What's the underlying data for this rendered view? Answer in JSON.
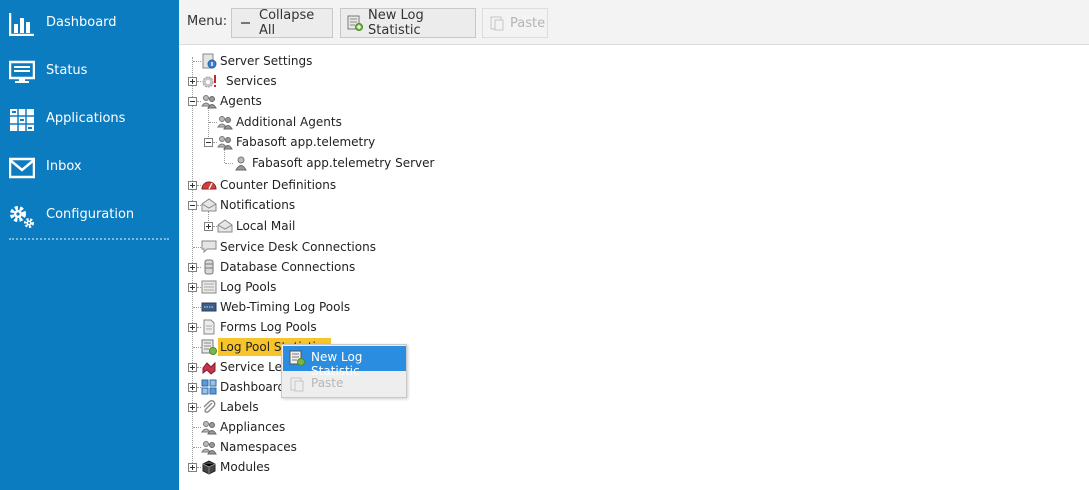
{
  "sidebar": {
    "items": [
      {
        "label": "Dashboard",
        "icon": "bar-chart-icon"
      },
      {
        "label": "Status",
        "icon": "monitor-icon"
      },
      {
        "label": "Applications",
        "icon": "grid-icon"
      },
      {
        "label": "Inbox",
        "icon": "envelope-icon"
      },
      {
        "label": "Configuration",
        "icon": "gears-icon"
      }
    ],
    "color": "#0c7cc0"
  },
  "toolbar": {
    "menu_label": "Menu:",
    "collapse_all_label": "Collapse All",
    "new_log_statistic_label": "New Log Statistic",
    "paste_label": "Paste"
  },
  "tree": {
    "nodes": [
      {
        "label": "Server Settings",
        "icon": "server-settings-icon"
      },
      {
        "label": "Services",
        "icon": "gear-warning-icon"
      },
      {
        "label": "Agents",
        "icon": "agents-icon"
      },
      {
        "label": "Additional Agents",
        "icon": "agents-icon"
      },
      {
        "label": "Fabasoft app.telemetry",
        "icon": "agents-icon"
      },
      {
        "label": "Fabasoft app.telemetry Server",
        "icon": "agent-icon"
      },
      {
        "label": "Counter Definitions",
        "icon": "gauge-icon"
      },
      {
        "label": "Notifications",
        "icon": "envelope-icon"
      },
      {
        "label": "Local Mail",
        "icon": "envelope-icon"
      },
      {
        "label": "Service Desk Connections",
        "icon": "speech-bubble-icon"
      },
      {
        "label": "Database Connections",
        "icon": "database-icon"
      },
      {
        "label": "Log Pools",
        "icon": "log-pool-icon"
      },
      {
        "label": "Web-Timing Log Pools",
        "icon": "web-timing-icon"
      },
      {
        "label": "Forms Log Pools",
        "icon": "form-icon"
      },
      {
        "label": "Log Pool Statistics",
        "icon": "log-statistic-icon"
      },
      {
        "label": "Service Levels",
        "icon": "service-level-icon"
      },
      {
        "label": "Dashboards",
        "icon": "dashboard-icon"
      },
      {
        "label": "Labels",
        "icon": "paperclip-icon"
      },
      {
        "label": "Appliances",
        "icon": "agents-icon"
      },
      {
        "label": "Namespaces",
        "icon": "agents-icon"
      },
      {
        "label": "Modules",
        "icon": "module-icon"
      }
    ],
    "selected_color": "#f7c42a"
  },
  "context_menu": {
    "new_log_statistic_label": "New Log Statistic",
    "paste_label": "Paste",
    "highlight_color": "#2a8de0"
  }
}
